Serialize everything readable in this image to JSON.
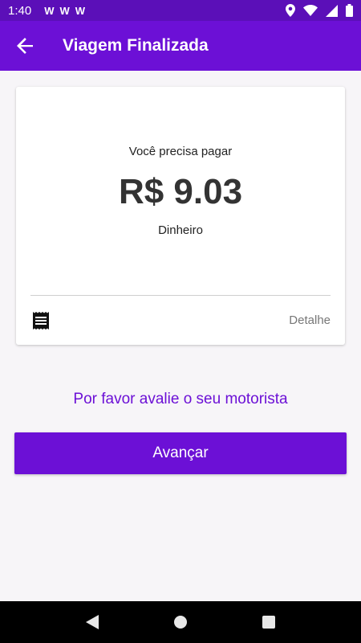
{
  "status_bar": {
    "time": "1:40",
    "notification_icons": [
      "W",
      "W",
      "W"
    ],
    "right_icons": [
      "location-icon",
      "wifi-icon",
      "signal-icon",
      "battery-icon"
    ]
  },
  "app_bar": {
    "title": "Viagem Finalizada",
    "back_icon": "arrow-back-icon",
    "color": "#6c10d6"
  },
  "payment_card": {
    "label": "Você precisa pagar",
    "amount": "R$ 9.03",
    "method": "Dinheiro",
    "receipt_icon": "receipt-icon",
    "detail_label": "Detalhe"
  },
  "rate_driver_label": "Por favor avalie o seu motorista",
  "next_button_label": "Avançar",
  "nav_bar": {
    "icons": [
      "back-triangle-icon",
      "home-circle-icon",
      "recents-square-icon"
    ]
  },
  "colors": {
    "primary": "#6c10d6",
    "status_bar": "#5b0fb8",
    "background": "#f7f5f8"
  }
}
